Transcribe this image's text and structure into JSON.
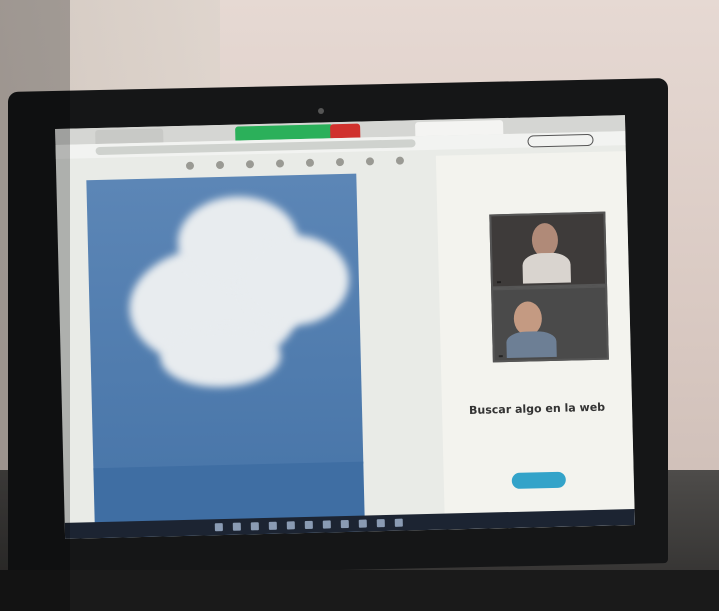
{
  "scene": {
    "description_type": "photo of a laptop screen showing a video call beside a slide"
  },
  "browser": {
    "tabs": [
      {
        "label": "",
        "style": "normal"
      },
      {
        "label": "",
        "style": "green"
      },
      {
        "label": "",
        "style": "red"
      },
      {
        "label": "",
        "style": "active"
      }
    ],
    "profile_label": ""
  },
  "video_call": {
    "participants": [
      {
        "name": ""
      },
      {
        "name": ""
      }
    ]
  },
  "sidebar": {
    "heading": "Buscar algo en la web",
    "description": "",
    "button_label": ""
  },
  "taskbar": {
    "time": "",
    "date": ""
  },
  "colors": {
    "slide_blue": "#4a77aa",
    "taskbar": "#1c2432",
    "cta": "#33a3c9"
  }
}
